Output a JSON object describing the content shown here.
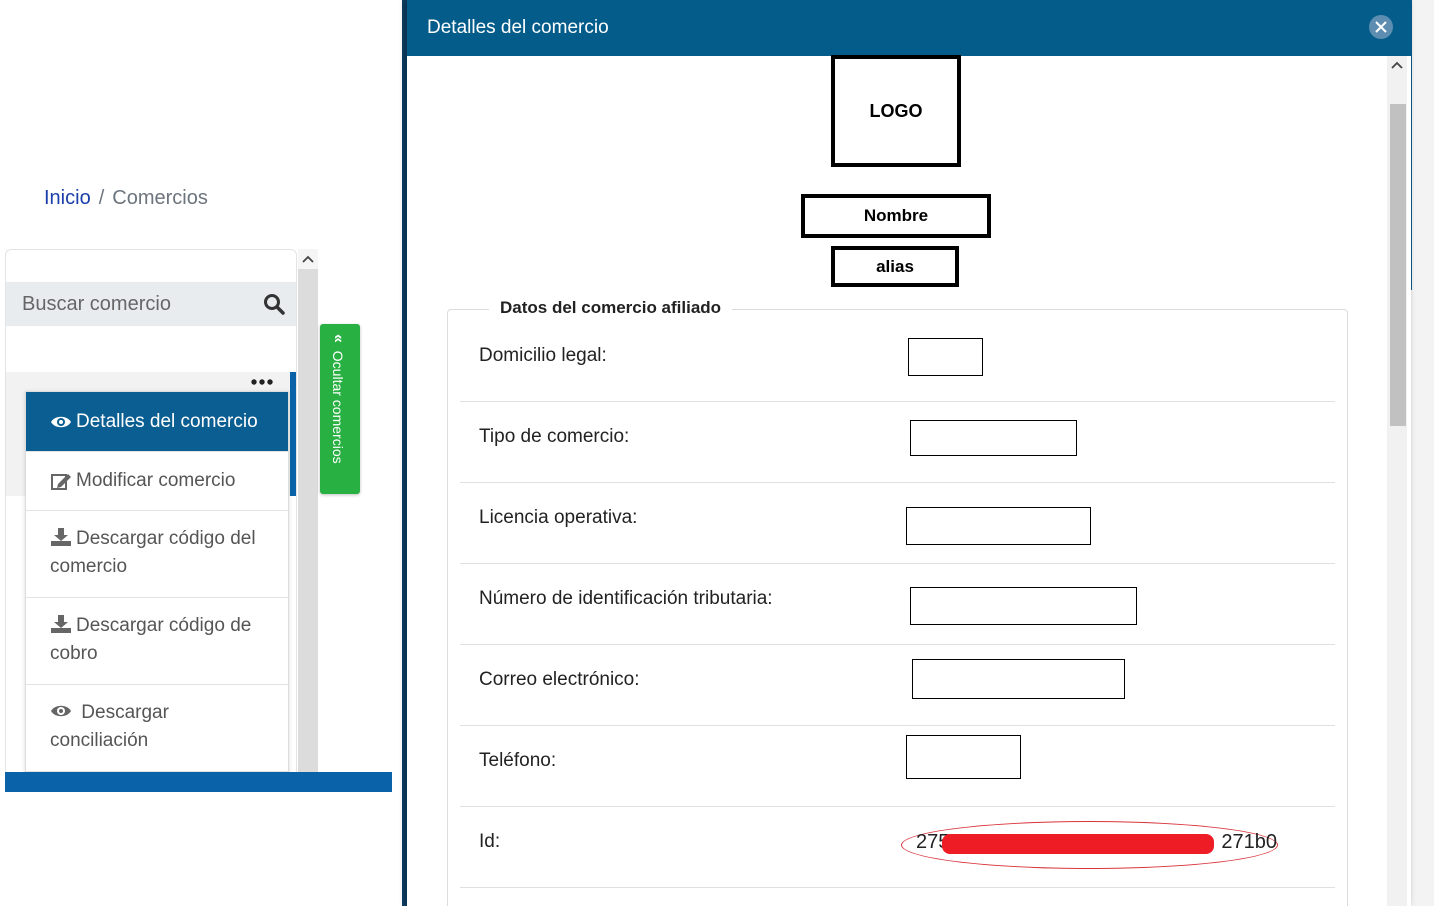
{
  "breadcrumb": {
    "home": "Inicio",
    "separator": "/",
    "current": "Comercios"
  },
  "sidebar": {
    "search_placeholder": "Buscar comercio",
    "hide_tab_label": "Ocultar comercios",
    "menu": [
      {
        "label": "Detalles del comercio",
        "icon": "eye-icon"
      },
      {
        "label": "Modificar comercio",
        "icon": "edit-icon"
      },
      {
        "label": "Descargar código del comercio",
        "icon": "download-icon"
      },
      {
        "label": "Descargar código de cobro",
        "icon": "download-icon"
      },
      {
        "label": "Descargar conciliación",
        "icon": "eye-icon"
      },
      {
        "label": "",
        "icon": "clipboard-icon"
      }
    ]
  },
  "modal": {
    "title": "Detalles del comercio",
    "logo": "LOGO",
    "name": "Nombre",
    "alias": "alias",
    "section_title": "Datos del comercio afiliado",
    "fields": [
      {
        "label": "Domicilio legal:"
      },
      {
        "label": "Tipo de comercio:"
      },
      {
        "label": "Licencia operativa:"
      },
      {
        "label": "Número de identificación tributaria:"
      },
      {
        "label": "Correo electrónico:"
      },
      {
        "label": "Teléfono:"
      },
      {
        "label": "Id:",
        "value_start": "275",
        "value_end": "271b0"
      }
    ]
  },
  "colors": {
    "header": "#045c8b",
    "active_item": "#0b5e92",
    "hide_tab": "#28b142",
    "link": "#1a3faa",
    "redaction": "#ee1c24"
  }
}
